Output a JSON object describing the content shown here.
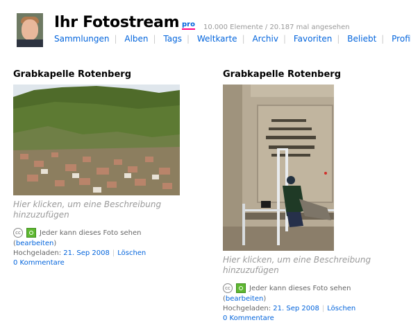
{
  "header": {
    "title": "Ihr Fotostream",
    "pro_badge": "pro",
    "stats": "10.000 Elemente / 20.187 mal angesehen",
    "nav": [
      "Sammlungen",
      "Alben",
      "Tags",
      "Weltkarte",
      "Archiv",
      "Favoriten",
      "Beliebt",
      "Profil"
    ]
  },
  "photos": [
    {
      "title": "Grabkapelle Rotenberg",
      "description": "Hier klicken, um eine Beschreibung hinzuzufügen",
      "visibility": "Jeder kann dieses Foto sehen",
      "edit_link": "bearbeiten",
      "uploaded_label": "Hochgeladen:",
      "uploaded_date": "21. Sep 2008",
      "delete_link": "Löschen",
      "comments": "0 Kommentare"
    },
    {
      "title": "Grabkapelle Rotenberg",
      "description": "Hier klicken, um eine Beschreibung hinzuzufügen",
      "visibility": "Jeder kann dieses Foto sehen",
      "edit_link": "bearbeiten",
      "uploaded_label": "Hochgeladen:",
      "uploaded_date": "21. Sep 2008",
      "delete_link": "Löschen",
      "comments": "0 Kommentare"
    }
  ],
  "icons": {
    "cc": "creative-commons-icon",
    "public": "public-visibility-icon"
  },
  "colors": {
    "link": "#0063dc",
    "pro_underline": "#ff0084",
    "public_icon": "#5fb831"
  }
}
